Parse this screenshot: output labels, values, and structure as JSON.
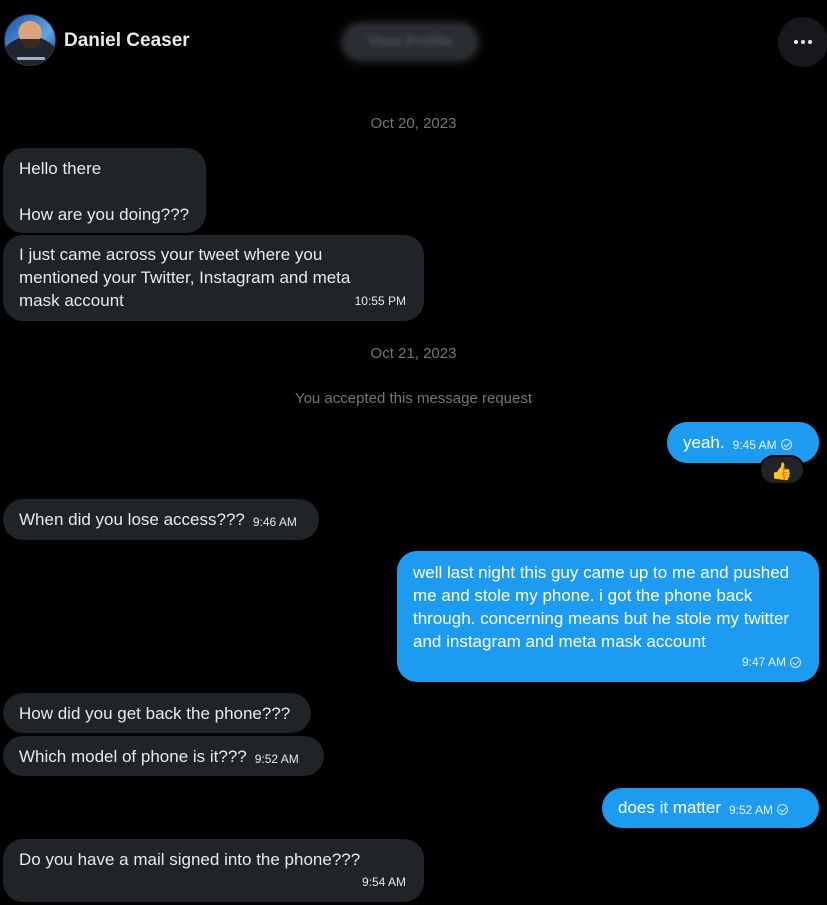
{
  "header": {
    "username": "Daniel Ceaser",
    "view_profile_label": "View Profile"
  },
  "dates": {
    "first": "Oct 20, 2023",
    "second": "Oct 21, 2023"
  },
  "system_note": "You accepted this message request",
  "messages": [
    {
      "direction": "in",
      "text": "Hello there\n\nHow are you doing???",
      "time": ""
    },
    {
      "direction": "in",
      "text": "I just came across your tweet where you mentioned your Twitter, Instagram and meta mask account",
      "time": "10:55 PM"
    },
    {
      "direction": "out",
      "text": "yeah.",
      "time": "9:45 AM",
      "reaction": "👍"
    },
    {
      "direction": "in",
      "text": "When did you lose access???",
      "time": "9:46 AM"
    },
    {
      "direction": "out",
      "text": "well last night this guy came up to me and pushed me and stole my phone. i got the phone back through. concerning means but he stole my twitter and instagram and meta mask account",
      "time": "9:47 AM"
    },
    {
      "direction": "in",
      "text": "How did you get back the phone???",
      "time": ""
    },
    {
      "direction": "in",
      "text": "Which model of phone is it???",
      "time": "9:52 AM"
    },
    {
      "direction": "out",
      "text": "does it matter",
      "time": "9:52 AM"
    },
    {
      "direction": "in",
      "text": "Do you have a mail signed into the phone???",
      "time": "9:54 AM"
    }
  ],
  "colors": {
    "background": "#000000",
    "incoming_bubble": "#202327",
    "outgoing_bubble": "#1d9bf0",
    "muted_text": "#71767b"
  },
  "icons": {
    "more": "more-horizontal-icon",
    "sent": "check-circle-icon",
    "reaction": "thumbs-up-emoji"
  }
}
